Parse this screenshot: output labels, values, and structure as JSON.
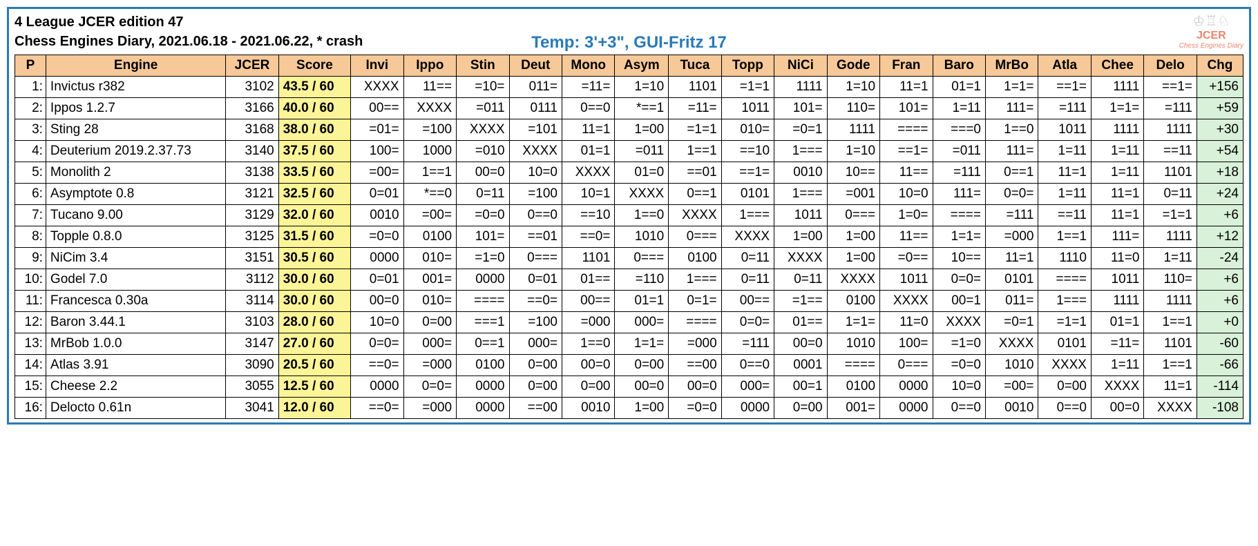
{
  "header": {
    "title1": "4 League JCER edition 47",
    "title2": "Chess Engines Diary, 2021.06.18 - 2021.06.22, * crash",
    "center": "Temp: 3'+3\", GUI-Fritz 17",
    "logo_text": "JCER",
    "logo_sub": "Chess Engines Diary"
  },
  "columns": [
    "P",
    "Engine",
    "JCER",
    "Score",
    "Invi",
    "Ippo",
    "Stin",
    "Deut",
    "Mono",
    "Asym",
    "Tuca",
    "Topp",
    "NiCi",
    "Gode",
    "Fran",
    "Baro",
    "MrBo",
    "Atla",
    "Chee",
    "Delo",
    "Chg"
  ],
  "rows": [
    {
      "p": "1:",
      "engine": "Invictus r382",
      "jcer": "3102",
      "score": "43.5 / 60",
      "r": [
        "XXXX",
        "11==",
        "=10=",
        "011=",
        "=11=",
        "1=10",
        "1101",
        "=1=1",
        "1111",
        "1=10",
        "11=1",
        "01=1",
        "1=1=",
        "==1=",
        "1111",
        "==1="
      ],
      "chg": "+156"
    },
    {
      "p": "2:",
      "engine": "Ippos 1.2.7",
      "jcer": "3166",
      "score": "40.0 / 60",
      "r": [
        "00==",
        "XXXX",
        "=011",
        "0111",
        "0==0",
        "*==1",
        "=11=",
        "1011",
        "101=",
        "110=",
        "101=",
        "1=11",
        "111=",
        "=111",
        "1=1=",
        "=111"
      ],
      "chg": "+59"
    },
    {
      "p": "3:",
      "engine": "Sting 28",
      "jcer": "3168",
      "score": "38.0 / 60",
      "r": [
        "=01=",
        "=100",
        "XXXX",
        "=101",
        "11=1",
        "1=00",
        "=1=1",
        "010=",
        "=0=1",
        "1111",
        "====",
        "===0",
        "1==0",
        "1011",
        "1111",
        "1111"
      ],
      "chg": "+30"
    },
    {
      "p": "4:",
      "engine": "Deuterium 2019.2.37.73",
      "jcer": "3140",
      "score": "37.5 / 60",
      "r": [
        "100=",
        "1000",
        "=010",
        "XXXX",
        "01=1",
        "=011",
        "1==1",
        "==10",
        "1===",
        "1=10",
        "==1=",
        "=011",
        "111=",
        "1=11",
        "1=11",
        "==11"
      ],
      "chg": "+54"
    },
    {
      "p": "5:",
      "engine": "Monolith 2",
      "jcer": "3138",
      "score": "33.5 / 60",
      "r": [
        "=00=",
        "1==1",
        "00=0",
        "10=0",
        "XXXX",
        "01=0",
        "==01",
        "==1=",
        "0010",
        "10==",
        "11==",
        "=111",
        "0==1",
        "11=1",
        "1=11",
        "1101"
      ],
      "chg": "+18"
    },
    {
      "p": "6:",
      "engine": "Asymptote 0.8",
      "jcer": "3121",
      "score": "32.5 / 60",
      "r": [
        "0=01",
        "*==0",
        "0=11",
        "=100",
        "10=1",
        "XXXX",
        "0==1",
        "0101",
        "1===",
        "=001",
        "10=0",
        "111=",
        "0=0=",
        "1=11",
        "11=1",
        "0=11"
      ],
      "chg": "+24"
    },
    {
      "p": "7:",
      "engine": "Tucano 9.00",
      "jcer": "3129",
      "score": "32.0 / 60",
      "r": [
        "0010",
        "=00=",
        "=0=0",
        "0==0",
        "==10",
        "1==0",
        "XXXX",
        "1===",
        "1011",
        "0===",
        "1=0=",
        "====",
        "=111",
        "==11",
        "11=1",
        "=1=1"
      ],
      "chg": "+6"
    },
    {
      "p": "8:",
      "engine": "Topple 0.8.0",
      "jcer": "3125",
      "score": "31.5 / 60",
      "r": [
        "=0=0",
        "0100",
        "101=",
        "==01",
        "==0=",
        "1010",
        "0===",
        "XXXX",
        "1=00",
        "1=00",
        "11==",
        "1=1=",
        "=000",
        "1==1",
        "111=",
        "1111"
      ],
      "chg": "+12"
    },
    {
      "p": "9:",
      "engine": "NiCim 3.4",
      "jcer": "3151",
      "score": "30.5 / 60",
      "r": [
        "0000",
        "010=",
        "=1=0",
        "0===",
        "1101",
        "0===",
        "0100",
        "0=11",
        "XXXX",
        "1=00",
        "=0==",
        "10==",
        "11=1",
        "1110",
        "11=0",
        "1=11"
      ],
      "chg": "-24"
    },
    {
      "p": "10:",
      "engine": "Godel 7.0",
      "jcer": "3112",
      "score": "30.0 / 60",
      "r": [
        "0=01",
        "001=",
        "0000",
        "0=01",
        "01==",
        "=110",
        "1===",
        "0=11",
        "0=11",
        "XXXX",
        "1011",
        "0=0=",
        "0101",
        "====",
        "1011",
        "110="
      ],
      "chg": "+6"
    },
    {
      "p": "11:",
      "engine": "Francesca 0.30a",
      "jcer": "3114",
      "score": "30.0 / 60",
      "r": [
        "00=0",
        "010=",
        "====",
        "==0=",
        "00==",
        "01=1",
        "0=1=",
        "00==",
        "=1==",
        "0100",
        "XXXX",
        "00=1",
        "011=",
        "1===",
        "1111",
        "1111"
      ],
      "chg": "+6"
    },
    {
      "p": "12:",
      "engine": "Baron 3.44.1",
      "jcer": "3103",
      "score": "28.0 / 60",
      "r": [
        "10=0",
        "0=00",
        "===1",
        "=100",
        "=000",
        "000=",
        "====",
        "0=0=",
        "01==",
        "1=1=",
        "11=0",
        "XXXX",
        "=0=1",
        "=1=1",
        "01=1",
        "1==1"
      ],
      "chg": "+0"
    },
    {
      "p": "13:",
      "engine": "MrBob 1.0.0",
      "jcer": "3147",
      "score": "27.0 / 60",
      "r": [
        "0=0=",
        "000=",
        "0==1",
        "000=",
        "1==0",
        "1=1=",
        "=000",
        "=111",
        "00=0",
        "1010",
        "100=",
        "=1=0",
        "XXXX",
        "0101",
        "=11=",
        "1101"
      ],
      "chg": "-60"
    },
    {
      "p": "14:",
      "engine": "Atlas 3.91",
      "jcer": "3090",
      "score": "20.5 / 60",
      "r": [
        "==0=",
        "=000",
        "0100",
        "0=00",
        "00=0",
        "0=00",
        "==00",
        "0==0",
        "0001",
        "====",
        "0===",
        "=0=0",
        "1010",
        "XXXX",
        "1=11",
        "1==1"
      ],
      "chg": "-66"
    },
    {
      "p": "15:",
      "engine": "Cheese 2.2",
      "jcer": "3055",
      "score": "12.5 / 60",
      "r": [
        "0000",
        "0=0=",
        "0000",
        "0=00",
        "0=00",
        "00=0",
        "00=0",
        "000=",
        "00=1",
        "0100",
        "0000",
        "10=0",
        "=00=",
        "0=00",
        "XXXX",
        "11=1"
      ],
      "chg": "-114"
    },
    {
      "p": "16:",
      "engine": "Delocto 0.61n",
      "jcer": "3041",
      "score": "12.0 / 60",
      "r": [
        "==0=",
        "=000",
        "0000",
        "==00",
        "0010",
        "1=00",
        "=0=0",
        "0000",
        "0=00",
        "001=",
        "0000",
        "0==0",
        "0010",
        "0==0",
        "00=0",
        "XXXX"
      ],
      "chg": "-108"
    }
  ]
}
